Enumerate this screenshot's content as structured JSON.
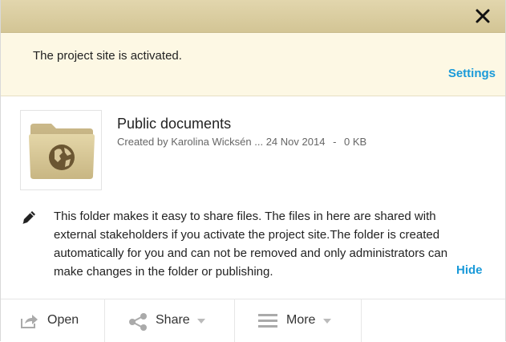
{
  "notice": {
    "message": "The project site is activated.",
    "settings_label": "Settings"
  },
  "item": {
    "title": "Public documents",
    "created_by": "Created by Karolina Wicksén ...",
    "date": "24 Nov 2014",
    "separator": "-",
    "size": "0 KB",
    "thumbnail_icon": "folder-globe-icon"
  },
  "description": {
    "text": "This folder makes it easy to share files. The files in here are shared with external stakeholders if you activate the project site.The folder is created automatically for you and can not be removed and only administrators can make changes in the folder or publishing.",
    "hide_label": "Hide"
  },
  "actions": {
    "open_label": "Open",
    "share_label": "Share",
    "more_label": "More"
  },
  "colors": {
    "topbar": "#d9cb9d",
    "notice_bg": "#fdf8e4",
    "link": "#1a9ad9"
  }
}
